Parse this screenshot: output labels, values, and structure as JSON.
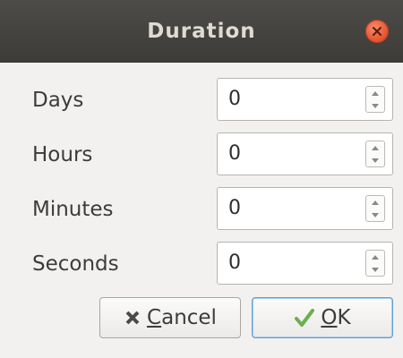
{
  "window": {
    "title": "Duration"
  },
  "fields": [
    {
      "label": "Days",
      "value": "0"
    },
    {
      "label": "Hours",
      "value": "0"
    },
    {
      "label": "Minutes",
      "value": "0"
    },
    {
      "label": "Seconds",
      "value": "0"
    }
  ],
  "buttons": {
    "cancel": {
      "mnemonic": "C",
      "rest": "ancel",
      "icon": "x-icon"
    },
    "ok": {
      "mnemonic": "O",
      "rest": "K",
      "icon": "checkmark-icon"
    }
  },
  "colors": {
    "titlebar": "#3c3b37",
    "title_text": "#dfdbd2",
    "close_button": "#e0502a",
    "background": "#f2f1f0",
    "ok_focus_border": "#5f9fd6",
    "checkmark": "#6ab04c"
  }
}
